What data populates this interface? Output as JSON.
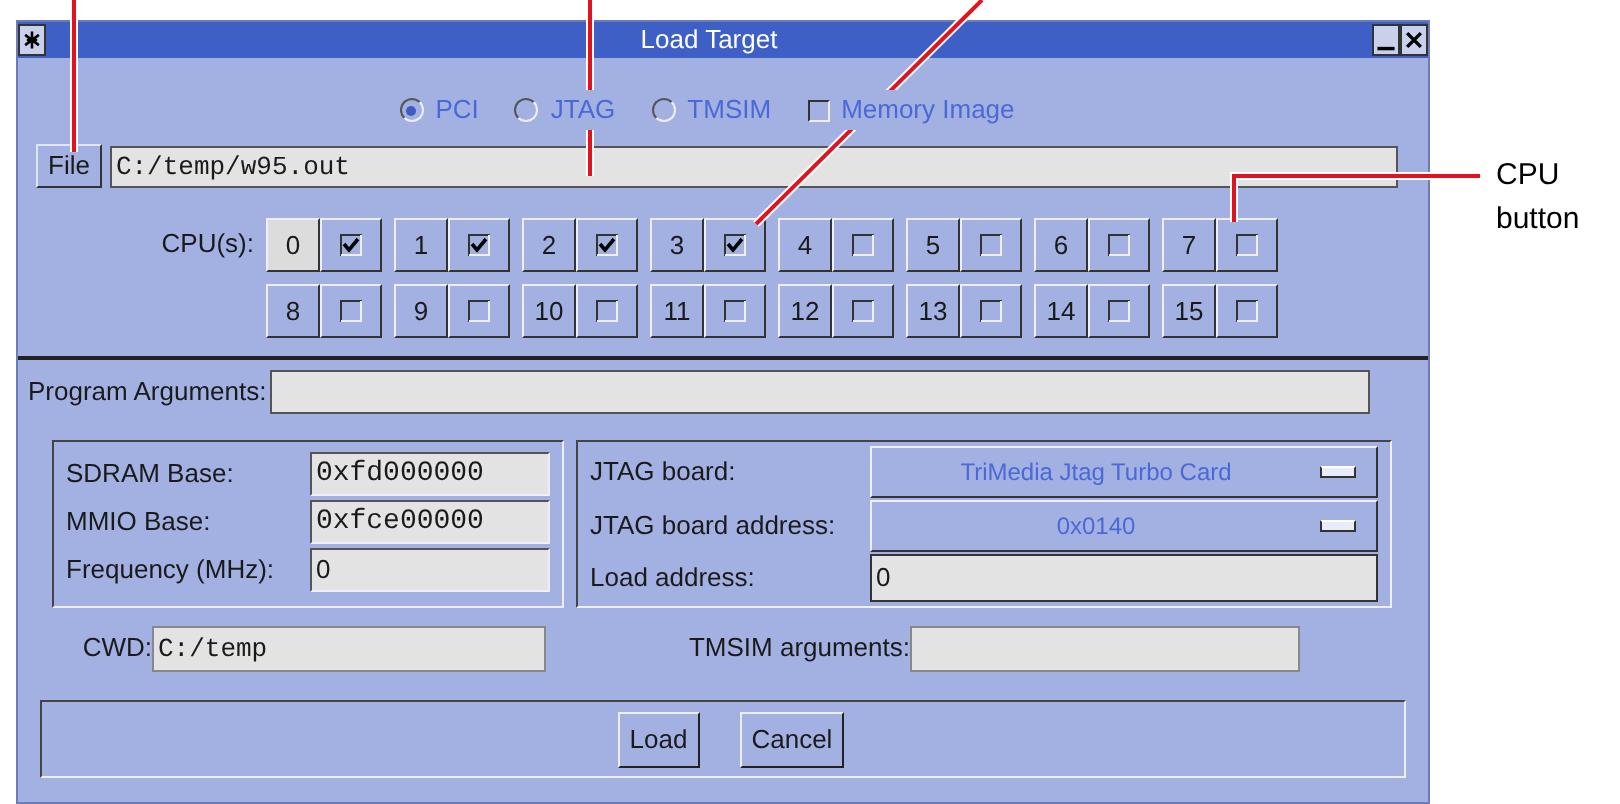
{
  "window": {
    "title": "Load Target"
  },
  "target_types": [
    {
      "label": "PCI",
      "selected": true
    },
    {
      "label": "JTAG",
      "selected": false
    },
    {
      "label": "TMSIM",
      "selected": false
    },
    {
      "label": "Memory Image",
      "kind": "checkbox",
      "checked": false
    }
  ],
  "file": {
    "button": "File",
    "value": "C:/temp/w95.out"
  },
  "cpus": {
    "label": "CPU(s):",
    "items": [
      {
        "label": "0",
        "selected": true,
        "checked": true
      },
      {
        "label": "1",
        "selected": false,
        "checked": true
      },
      {
        "label": "2",
        "selected": false,
        "checked": true
      },
      {
        "label": "3",
        "selected": false,
        "checked": true
      },
      {
        "label": "4",
        "selected": false,
        "checked": false
      },
      {
        "label": "5",
        "selected": false,
        "checked": false
      },
      {
        "label": "6",
        "selected": false,
        "checked": false
      },
      {
        "label": "7",
        "selected": false,
        "checked": false
      },
      {
        "label": "8",
        "selected": false,
        "checked": false
      },
      {
        "label": "9",
        "selected": false,
        "checked": false
      },
      {
        "label": "10",
        "selected": false,
        "checked": false
      },
      {
        "label": "11",
        "selected": false,
        "checked": false
      },
      {
        "label": "12",
        "selected": false,
        "checked": false
      },
      {
        "label": "13",
        "selected": false,
        "checked": false
      },
      {
        "label": "14",
        "selected": false,
        "checked": false
      },
      {
        "label": "15",
        "selected": false,
        "checked": false
      }
    ]
  },
  "program_arguments": {
    "label": "Program Arguments:"
  },
  "memory_panel": [
    {
      "label": "SDRAM Base:",
      "value": "0xfd000000",
      "mono": true
    },
    {
      "label": "MMIO Base:",
      "value": "0xfce00000",
      "mono": true
    },
    {
      "label": "Frequency (MHz):",
      "value": "0",
      "mono": false
    }
  ],
  "jtag_panel": [
    {
      "label": "JTAG board:",
      "kind": "dropdown",
      "value": "TriMedia Jtag Turbo Card"
    },
    {
      "label": "JTAG board address:",
      "kind": "dropdown",
      "value": "0x0140"
    },
    {
      "label": "Load address:",
      "kind": "field",
      "value": "0"
    }
  ],
  "cwd": {
    "label": "CWD:",
    "value": "C:/temp"
  },
  "tmsim_arguments": {
    "label": "TMSIM arguments:"
  },
  "buttons": [
    "Load",
    "Cancel"
  ],
  "callout": {
    "label": "CPU button"
  }
}
